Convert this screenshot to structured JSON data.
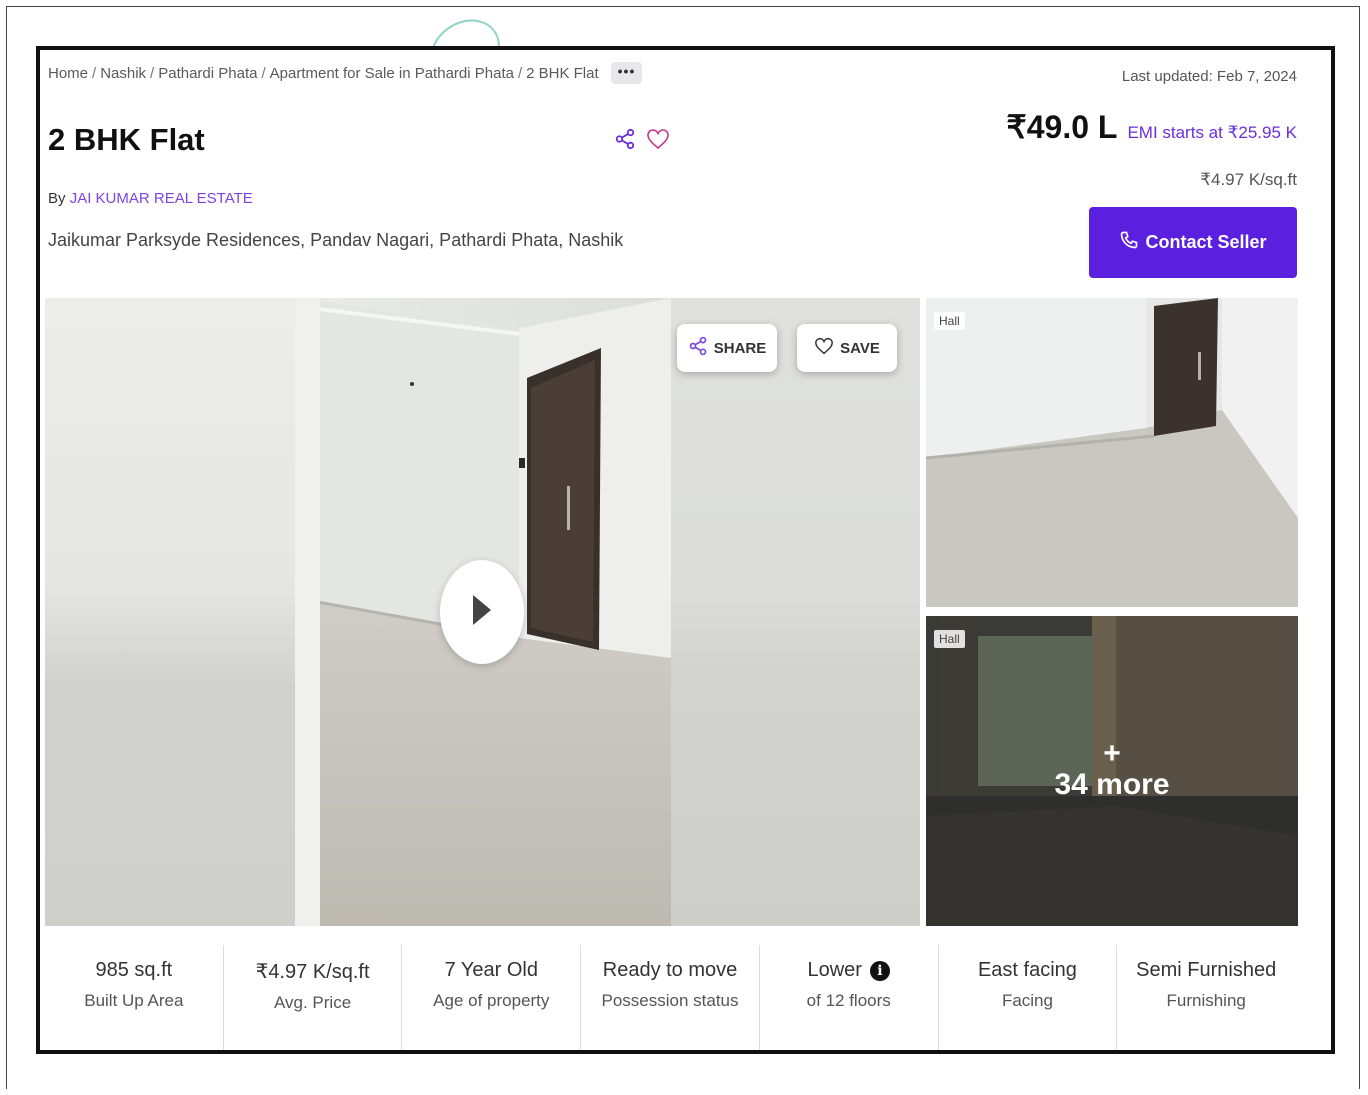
{
  "breadcrumb": {
    "items": [
      "Home",
      "Nashik",
      "Pathardi Phata",
      "Apartment for Sale in Pathardi Phata",
      "2 BHK Flat"
    ],
    "separator": "/",
    "more_label": "•••"
  },
  "last_updated": "Last updated: Feb 7, 2024",
  "listing": {
    "title": "2 BHK Flat",
    "by_prefix": "By",
    "seller": "JAI KUMAR REAL ESTATE",
    "address": "Jaikumar Parksyde Residences, Pandav Nagari, Pathardi Phata, Nashik",
    "price": "₹49.0 L",
    "emi": "EMI starts at ₹25.95 K",
    "price_per_sqft": "₹4.97 K/sq.ft",
    "contact_label": "Contact Seller"
  },
  "gallery": {
    "share_label": "SHARE",
    "save_label": "SAVE",
    "thumb1_tag": "Hall",
    "thumb2_tag": "Hall",
    "more_plus": "+",
    "more_text": "34 more"
  },
  "stats": [
    {
      "value": "985 sq.ft",
      "label": "Built Up Area"
    },
    {
      "value": "₹4.97 K/sq.ft",
      "label": "Avg. Price"
    },
    {
      "value": "7 Year Old",
      "label": "Age of property"
    },
    {
      "value": "Ready to move",
      "label": "Possession status"
    },
    {
      "value": "Lower",
      "label": "of 12 floors"
    },
    {
      "value": "East facing",
      "label": "Facing"
    },
    {
      "value": "Semi Furnished",
      "label": "Furnishing"
    }
  ],
  "colors": {
    "accent": "#5b1fe0",
    "link": "#7b45e3",
    "heart": "#c23a8c"
  }
}
